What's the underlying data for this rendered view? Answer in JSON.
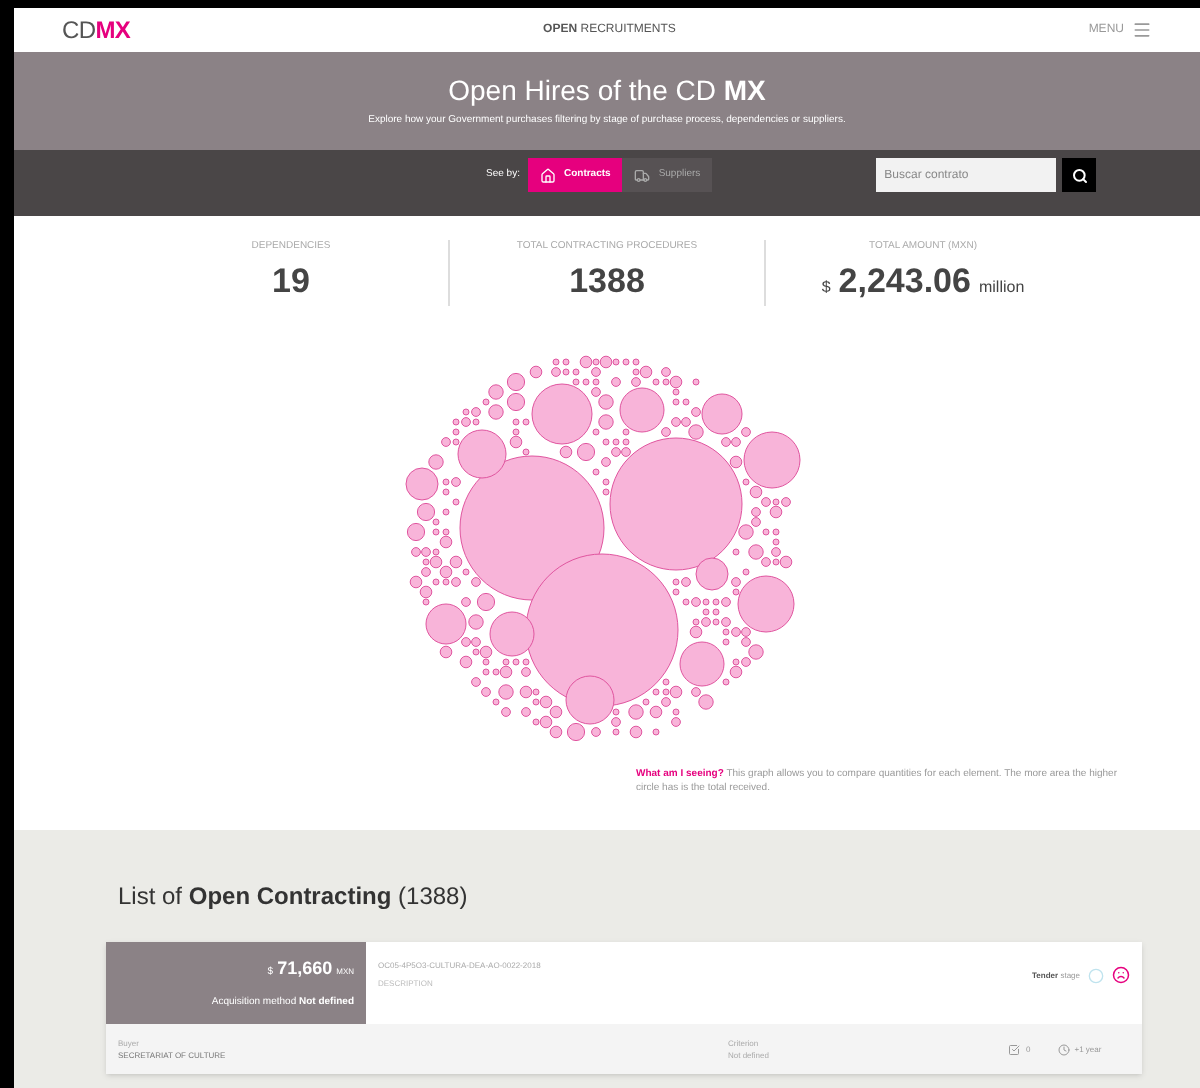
{
  "header": {
    "logo": {
      "prefix": "CD",
      "accent": "MX"
    },
    "nav": {
      "bold": "OPEN",
      "rest": "RECRUITMENTS"
    },
    "menu": "MENU"
  },
  "banner": {
    "title": "Open Hires of the CD **MX**",
    "subtitle": "Explore how your Government purchases filtering by stage of purchase process, dependencies or suppliers."
  },
  "filter": {
    "label": "See by:",
    "options": [
      {
        "kind": "contracts",
        "label": "Contracts",
        "selected": true
      },
      {
        "kind": "suppliers",
        "label": "Suppliers",
        "selected": false
      }
    ],
    "search": {
      "placeholder": "Buscar contrato"
    }
  },
  "stats": [
    {
      "label": "DEPENDENCIES",
      "value": "19"
    },
    {
      "label": "TOTAL CONTRACTING PROCEDURES",
      "value": "1388"
    },
    {
      "label": "TOTAL AMOUNT (MXN)",
      "prefix": "$",
      "value": "2,243.06",
      "suffix": "million"
    }
  ],
  "chart_note": "**What am I seeing?** This graph allows you to compare quantities for each element. The more area the higher circle has is the total received.",
  "list": {
    "title": "List of **Open Contracting** (1388)",
    "contracts": [
      {
        "currency_sign": "$",
        "amount": "71,660",
        "currency": "MXN",
        "method_label": "Acquisition method",
        "method": "Not defined",
        "code": "OC05-4P5O3-CULTURA-DEA-AO-0022-2018",
        "description": "DESCRIPTION",
        "stage": "Tender",
        "stage_suffix": "stage",
        "buyer_label": "Buyer",
        "buyer": "SECRETARIAT OF CULTURE",
        "criterion_label": "Criterion",
        "criterion": "Not defined",
        "count": "0",
        "time": "+1 year"
      }
    ]
  }
}
